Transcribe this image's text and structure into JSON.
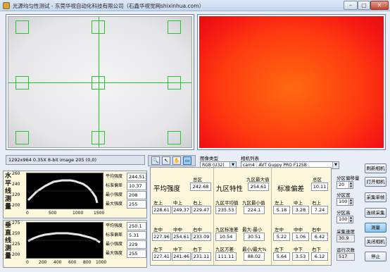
{
  "window": {
    "title": "光源均匀性测试 - 东莞华视自动化科技有限公司（石鑫华视觉网shixinhua.com）",
    "min_symbol": "–",
    "max_symbol": "▢",
    "close_symbol": "✕"
  },
  "status_text": "1292x964 0.35X 8-bit image 205    (0,0)",
  "tools": {
    "zoom_symbol": "🔍",
    "select_symbol": "↖",
    "pan_symbol": "✋",
    "rect_symbol": "▭"
  },
  "image_type": {
    "label": "图像类型",
    "value": "RGB (U32)"
  },
  "camera_list": {
    "label": "相机列表",
    "value": "cam4 : AVT Guppy PRO F125B"
  },
  "horizontal_profile": {
    "label": "水平线测量",
    "y_ticks": [
      "260",
      "240",
      "220",
      "200"
    ],
    "x_ticks": [
      "0",
      "500",
      "1000",
      "1500"
    ],
    "stats": [
      {
        "label": "平均强度",
        "value": "244.51"
      },
      {
        "label": "标准偏差",
        "value": "10.37"
      },
      {
        "label": "最小强度",
        "value": "208"
      },
      {
        "label": "最大强度",
        "value": "255"
      }
    ]
  },
  "vertical_profile": {
    "label": "垂直线测量",
    "y_ticks": [
      "275",
      "250",
      "225",
      "200"
    ],
    "x_ticks": [
      "0",
      "200",
      "400",
      "600",
      "800",
      "1000"
    ],
    "stats": [
      {
        "label": "平均强度",
        "value": "250.1"
      },
      {
        "label": "标准偏差",
        "value": "5.31"
      },
      {
        "label": "最小强度",
        "value": "229"
      },
      {
        "label": "最大强度",
        "value": "255"
      }
    ]
  },
  "average_intensity": {
    "title": "平均强度",
    "total_label": "总区",
    "total_value": "242.68",
    "rows": [
      [
        "左上",
        "中上",
        "右上"
      ],
      [
        "228.61",
        "249.37",
        "229.47"
      ],
      [
        "左中",
        "中中",
        "右中"
      ],
      [
        "227.96",
        "254.61",
        "233.09"
      ],
      [
        "左下",
        "中下",
        "右下"
      ],
      [
        "227.41",
        "241.46",
        "231.11"
      ]
    ]
  },
  "nine_zone": {
    "title": "九区特性",
    "max_label": "九区最大值",
    "max_value": "254.61",
    "avg_label": "九区平均值",
    "avg_value": "235.53",
    "min_label": "九区最小值",
    "min_value": "224.1",
    "std_label": "九区标准差",
    "std_value": "10.54",
    "range_label": "最大-最小",
    "range_value": "30.51",
    "var_label": "九区方差",
    "var_value": "111.11",
    "ratio_label": "最小/最大%",
    "ratio_value": "88.02"
  },
  "std_deviation": {
    "title": "标准偏差",
    "total_label": "总区",
    "total_value": "10.11",
    "rows": [
      [
        "左上",
        "中上",
        "右上"
      ],
      [
        "5.18",
        "3.28",
        "7.24"
      ],
      [
        "左中",
        "中中",
        "右中"
      ],
      [
        "5.22",
        "1.06",
        "6.42"
      ],
      [
        "左下",
        "中下",
        "右下"
      ],
      [
        "5.64",
        "3.53",
        "6.12"
      ]
    ]
  },
  "controls": {
    "offset_label": "分区偏移量",
    "offset_value": "20",
    "width_label": "分区宽",
    "width_value": "100",
    "height_label": "分区高",
    "height_value": "100",
    "speed_label": "采集速度",
    "speed_value": "30.9",
    "count_label": "运行次数",
    "count_value": "517"
  },
  "buttons": {
    "refresh": "刷新相机",
    "open": "打开相机",
    "single": "采集单帧",
    "continuous": "连续采集",
    "measure": "测量",
    "close_cam": "关闭相机",
    "stop": "停止"
  },
  "colors": {
    "crosshair": "#23c823",
    "heatmap_center": "#ff6a10",
    "heatmap_edge": "#e01010",
    "panel_bg": "#fdf7dc"
  }
}
